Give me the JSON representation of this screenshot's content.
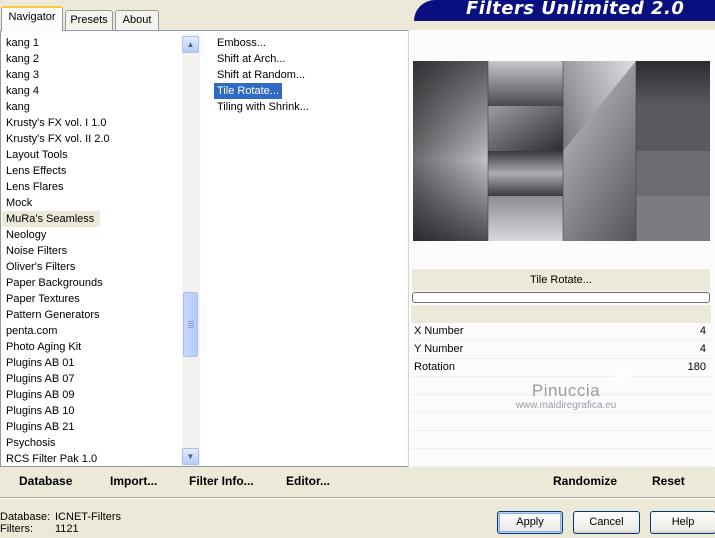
{
  "tabs": [
    {
      "label": "Navigator",
      "active": true
    },
    {
      "label": "Presets",
      "active": false
    },
    {
      "label": "About",
      "active": false
    }
  ],
  "banner": {
    "title": "Filters Unlimited 2.0"
  },
  "categories": [
    "kang 1",
    "kang 2",
    "kang 3",
    "kang 4",
    "kang",
    "Krusty's FX vol. I 1.0",
    "Krusty's FX vol. II 2.0",
    "Layout Tools",
    "Lens Effects",
    "Lens Flares",
    "Mock",
    "MuRa's Seamless",
    "Neology",
    "Noise Filters",
    "Oliver's Filters",
    "Paper Backgrounds",
    "Paper Textures",
    "Pattern Generators",
    "penta.com",
    "Photo Aging Kit",
    "Plugins AB 01",
    "Plugins AB 07",
    "Plugins AB 09",
    "Plugins AB 10",
    "Plugins AB 21",
    "Psychosis",
    "RCS Filter Pak 1.0"
  ],
  "selected_category": "MuRa's Seamless",
  "filters": [
    "Emboss...",
    "Shift at Arch...",
    "Shift at Random...",
    "Tile Rotate...",
    "Tiling with Shrink..."
  ],
  "selected_filter": "Tile Rotate...",
  "filter_name": "Tile Rotate...",
  "params": [
    {
      "label": "X Number",
      "value": "4"
    },
    {
      "label": "Y Number",
      "value": "4"
    },
    {
      "label": "Rotation",
      "value": "180"
    }
  ],
  "watermark": {
    "line1": "Pinuccia",
    "line2": "www.maidiregrafica.eu"
  },
  "bottom_links": {
    "database": "Database",
    "import": "Import...",
    "filter_info": "Filter Info...",
    "editor": "Editor...",
    "randomize": "Randomize",
    "reset": "Reset"
  },
  "status": {
    "database_label": "Database:",
    "database_value": "ICNET-Filters",
    "filters_label": "Filters:",
    "filters_value": "1121"
  },
  "dialog_buttons": {
    "apply": "Apply",
    "cancel": "Cancel",
    "help": "Help"
  },
  "colors": {
    "selection": "#316AC5",
    "banner": "#0A0F80",
    "face": "#ECE9D8"
  }
}
